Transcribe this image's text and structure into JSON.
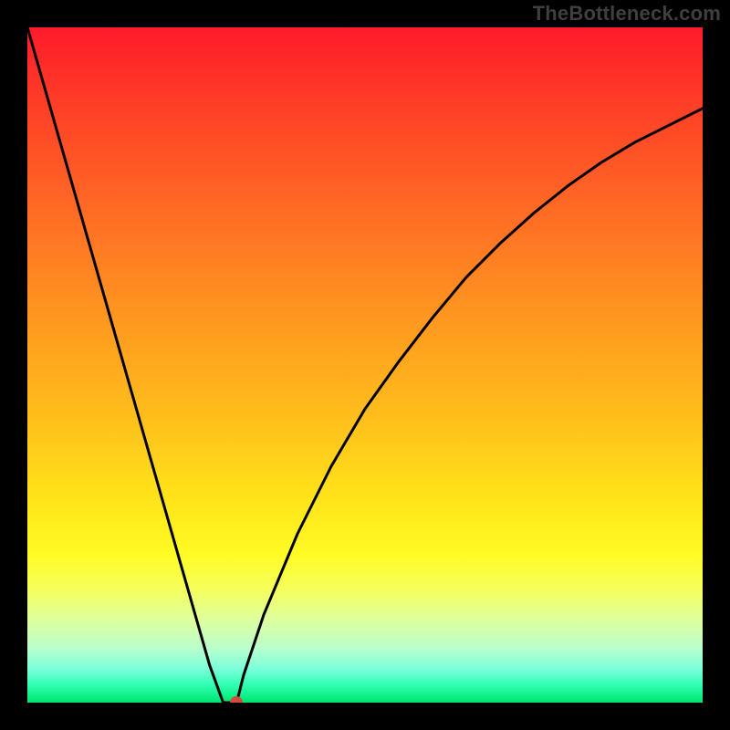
{
  "watermark": "TheBottleneck.com",
  "chart_data": {
    "type": "line",
    "title": "",
    "xlabel": "",
    "ylabel": "",
    "xlim": [
      0,
      100
    ],
    "ylim": [
      0,
      100
    ],
    "grid": false,
    "legend": false,
    "background_gradient_stops": [
      {
        "pos": 0,
        "color": "#fe1b2b"
      },
      {
        "pos": 12,
        "color": "#fe4027"
      },
      {
        "pos": 28,
        "color": "#ff6d25"
      },
      {
        "pos": 43,
        "color": "#ff9720"
      },
      {
        "pos": 58,
        "color": "#ffbf1c"
      },
      {
        "pos": 70,
        "color": "#ffe41a"
      },
      {
        "pos": 78,
        "color": "#fffb24"
      },
      {
        "pos": 83,
        "color": "#f6ff5a"
      },
      {
        "pos": 88,
        "color": "#dcffa1"
      },
      {
        "pos": 92,
        "color": "#b9ffce"
      },
      {
        "pos": 95,
        "color": "#7bffda"
      },
      {
        "pos": 97.5,
        "color": "#2cffb0"
      },
      {
        "pos": 100,
        "color": "#00e46d"
      }
    ],
    "series": [
      {
        "name": "bottleneck-curve",
        "x": [
          0,
          5,
          10,
          15,
          20,
          25,
          27,
          29,
          30,
          31,
          32,
          35,
          40,
          45,
          50,
          55,
          60,
          65,
          70,
          75,
          80,
          85,
          90,
          95,
          100
        ],
        "y": [
          100,
          82.5,
          65,
          47.5,
          30,
          12.5,
          5.5,
          0,
          0,
          0,
          4,
          13,
          25,
          35,
          43.5,
          50.5,
          57,
          63,
          68,
          72.5,
          76.5,
          80,
          83,
          85.5,
          88
        ]
      }
    ],
    "marker": {
      "x": 31,
      "y": 0,
      "color": "#d24d3c"
    }
  }
}
